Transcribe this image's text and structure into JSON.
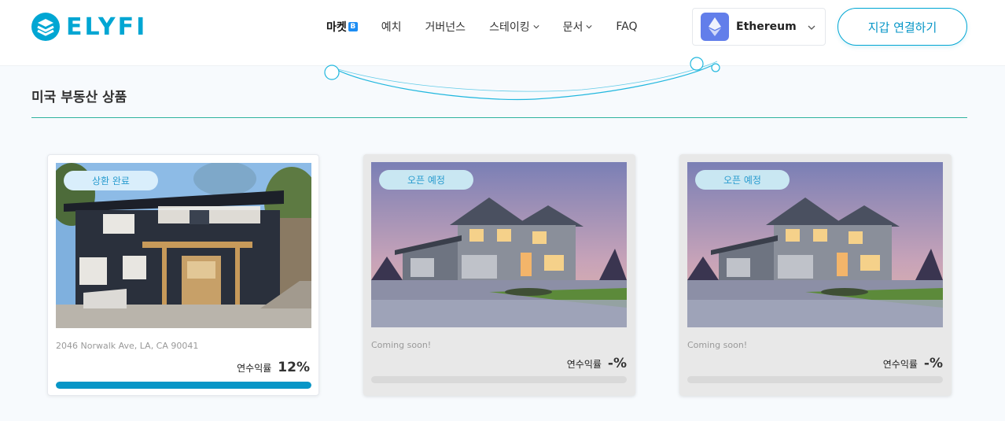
{
  "header": {
    "logo_text": "ELYFI",
    "nav": [
      {
        "label": "마켓",
        "badge": "B",
        "active": true
      },
      {
        "label": "예치"
      },
      {
        "label": "거버넌스"
      },
      {
        "label": "스테이킹",
        "dropdown": true
      },
      {
        "label": "문서",
        "dropdown": true
      },
      {
        "label": "FAQ"
      }
    ],
    "network": {
      "label": "Ethereum",
      "icon": "ethereum-icon"
    },
    "connect_label": "지갑 연결하기"
  },
  "section": {
    "title": "미국 부동산 상품"
  },
  "cards": [
    {
      "status": "상환 완료",
      "address": "2046 Norwalk Ave, LA, CA 90041",
      "yield_label": "연수익률",
      "yield_value": "12%",
      "progress": 1.0,
      "state": "active"
    },
    {
      "status": "오픈 예정",
      "address": "Coming soon!",
      "yield_label": "연수익률",
      "yield_value": "-%",
      "progress": 0,
      "state": "pending"
    },
    {
      "status": "오픈 예정",
      "address": "Coming soon!",
      "yield_label": "연수익률",
      "yield_value": "-%",
      "progress": 0,
      "state": "pending"
    }
  ],
  "colors": {
    "brand": "#00a6d3",
    "accent_line": "#2fb39f",
    "progress": "#0796c7",
    "ethereum": "#627eea"
  }
}
